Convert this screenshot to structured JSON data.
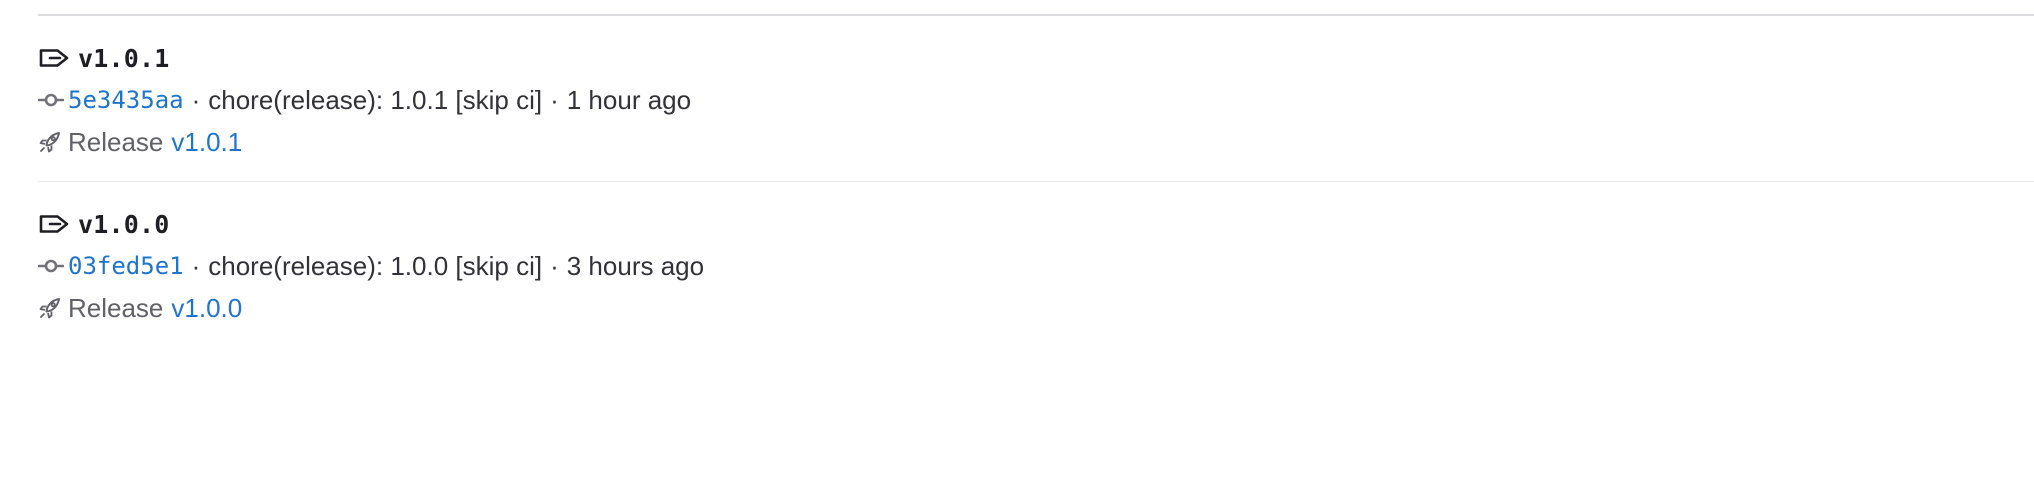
{
  "tags": [
    {
      "name": "v1.0.1",
      "commit": {
        "sha": "5e3435aa",
        "message": "chore(release): 1.0.1 [skip ci]",
        "time": "1 hour ago"
      },
      "release": {
        "label": "Release",
        "link": "v1.0.1"
      }
    },
    {
      "name": "v1.0.0",
      "commit": {
        "sha": "03fed5e1",
        "message": "chore(release): 1.0.0 [skip ci]",
        "time": "3 hours ago"
      },
      "release": {
        "label": "Release",
        "link": "v1.0.0"
      }
    }
  ],
  "separator": "·",
  "icons": {
    "tag": "tag-icon",
    "commit": "commit-icon",
    "release": "rocket-icon"
  },
  "colors": {
    "link": "#1f75cb",
    "text": "#333238",
    "heading": "#1f1e24",
    "muted": "#626168",
    "divider": "#dcdcde"
  }
}
